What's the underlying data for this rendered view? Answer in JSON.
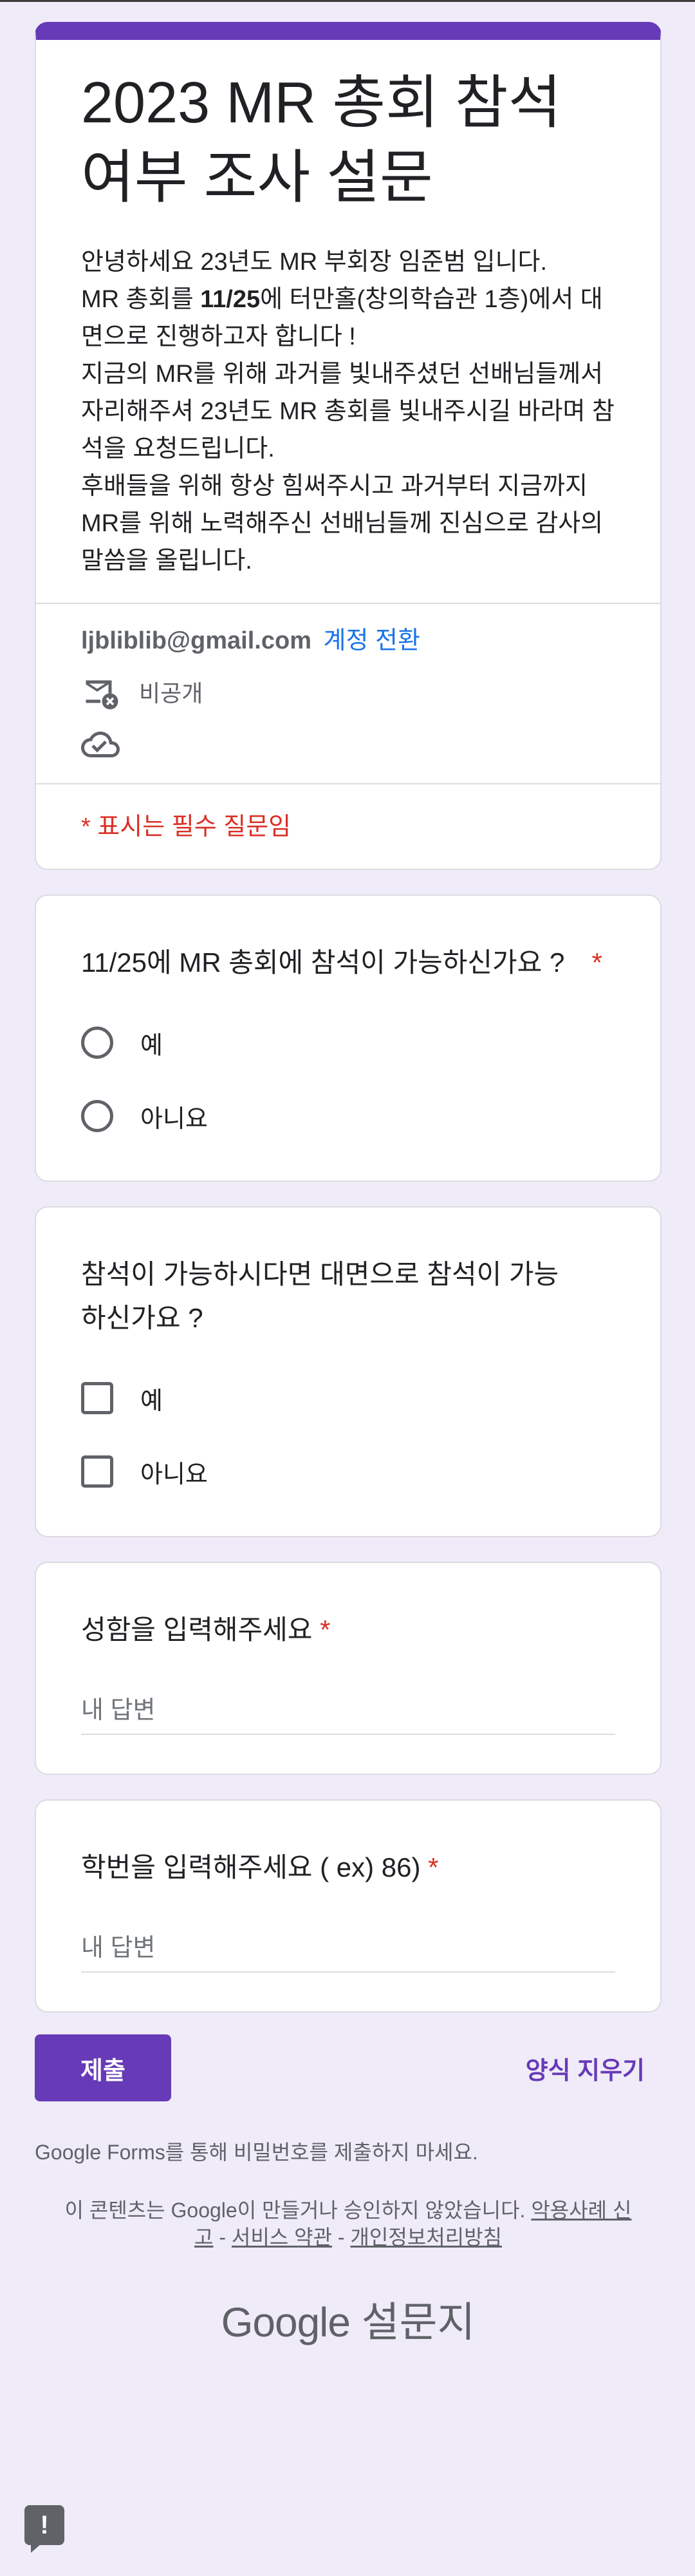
{
  "form": {
    "title": "2023 MR 총회 참석 여부 조사 설문",
    "description": {
      "line1": "안녕하세요 23년도 MR 부회장 임준범 입니다.",
      "line2_pre": "MR 총회를 ",
      "line2_bold": "11/25",
      "line2_post": "에 터만홀(창의학습관 1층)에서 대면으로 진행하고자 합니다 !",
      "line3": "지금의 MR를 위해 과거를 빛내주셨던 선배님들께서 자리해주셔 23년도 MR 총회를 빛내주시길 바라며 참석을 요청드립니다.",
      "line4": "후배들을 위해 항상 힘써주시고 과거부터 지금까지 MR를 위해 노력해주신 선배님들께 진심으로 감사의 말씀을 올립니다."
    }
  },
  "account": {
    "email": "ljbliblib@gmail.com",
    "switch_label": "계정 전환",
    "privacy_label": "비공개"
  },
  "required_note": "* 표시는 필수 질문임",
  "questions": [
    {
      "title": "11/25에 MR 총회에 참석이 가능하신가요 ?",
      "required_mark": "*",
      "options": [
        "예",
        "아니요"
      ]
    },
    {
      "title": "참석이 가능하시다면 대면으로 참석이 가능하신가요 ?",
      "options": [
        "예",
        "아니요"
      ]
    },
    {
      "title": "성함을 입력해주세요",
      "required_mark": "*",
      "placeholder": "내 답변"
    },
    {
      "title": "학번을 입력해주세요 ( ex) 86)",
      "required_mark": "*",
      "placeholder": "내 답변"
    }
  ],
  "actions": {
    "submit_label": "제출",
    "clear_label": "양식 지우기"
  },
  "footer": {
    "warning": "Google Forms를 통해 비밀번호를 제출하지 마세요.",
    "disclaimer_pre": "이 콘텐츠는 Google이 만들거나 승인하지 않았습니다. ",
    "abuse_link": "악용사례 신고",
    "sep1": " - ",
    "terms_link": "서비스 약관",
    "sep2": " - ",
    "privacy_link": "개인정보처리방침",
    "brand_google": "Google",
    "brand_product": "설문지",
    "report_icon_glyph": "!"
  },
  "colors": {
    "accent": "#673ab7",
    "background": "#f0ebf8",
    "required": "#d93025",
    "link": "#1a73e8"
  }
}
